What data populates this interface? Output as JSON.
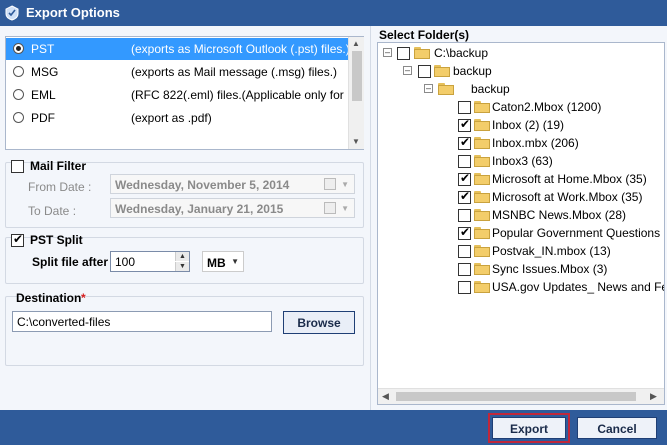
{
  "window": {
    "title": "Export Options",
    "icon": "app-logo-icon"
  },
  "formats": [
    {
      "name": "PST",
      "desc": "(exports as Microsoft Outlook (.pst) files.)",
      "selected": true
    },
    {
      "name": "MSG",
      "desc": "(exports as Mail message (.msg) files.)",
      "selected": false
    },
    {
      "name": "EML",
      "desc": "(RFC 822(.eml) files.(Applicable only for ...",
      "selected": false
    },
    {
      "name": "PDF",
      "desc": "(export as .pdf)",
      "selected": false
    }
  ],
  "mail_filter": {
    "label": "Mail Filter",
    "checked": false,
    "from_label": "From Date :",
    "from_value": "Wednesday, November   5, 2014",
    "to_label": "To Date :",
    "to_value": "Wednesday,   January   21, 2015"
  },
  "pst_split": {
    "label": "PST Split",
    "checked": true,
    "split_label": "Split file after",
    "split_value": "100",
    "unit": "MB"
  },
  "destination": {
    "label": "Destination",
    "required_mark": "*",
    "path": "C:\\converted-files",
    "browse_label": "Browse"
  },
  "folders": {
    "title": "Select Folder(s)",
    "root": "C:\\backup",
    "child": "backup",
    "grandchild": "backup",
    "items": [
      {
        "name": "Caton2.Mbox (1200)",
        "checked": false
      },
      {
        "name": "Inbox (2) (19)",
        "checked": true
      },
      {
        "name": "Inbox.mbx (206)",
        "checked": true
      },
      {
        "name": "Inbox3 (63)",
        "checked": false
      },
      {
        "name": "Microsoft at Home.Mbox (35)",
        "checked": true
      },
      {
        "name": "Microsoft at Work.Mbox (35)",
        "checked": true
      },
      {
        "name": "MSNBC News.Mbox (28)",
        "checked": false
      },
      {
        "name": "Popular Government Questions",
        "checked": true
      },
      {
        "name": "Postvak_IN.mbox (13)",
        "checked": false
      },
      {
        "name": "Sync Issues.Mbox (3)",
        "checked": false
      },
      {
        "name": "USA.gov Updates_ News and Fe",
        "checked": false
      }
    ]
  },
  "footer": {
    "export_label": "Export",
    "cancel_label": "Cancel"
  }
}
